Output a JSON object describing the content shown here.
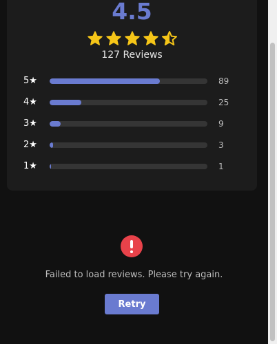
{
  "summary": {
    "average": "4.5",
    "rating_value": 4.5,
    "rating_max": 5,
    "review_count_text": "127 Reviews"
  },
  "breakdown": [
    {
      "label": "5★",
      "count": "89",
      "fraction": 0.7
    },
    {
      "label": "4★",
      "count": "25",
      "fraction": 0.2
    },
    {
      "label": "3★",
      "count": "9",
      "fraction": 0.07
    },
    {
      "label": "2★",
      "count": "3",
      "fraction": 0.02
    },
    {
      "label": "1★",
      "count": "1",
      "fraction": 0.01
    }
  ],
  "error": {
    "icon": "alert-circle-icon",
    "message": "Failed to load reviews. Please try again.",
    "retry_label": "Retry"
  },
  "colors": {
    "accent": "#6a7bd0",
    "star": "#f5c518",
    "error": "#e8424a",
    "background": "#111111",
    "card": "#1c1c1c"
  }
}
